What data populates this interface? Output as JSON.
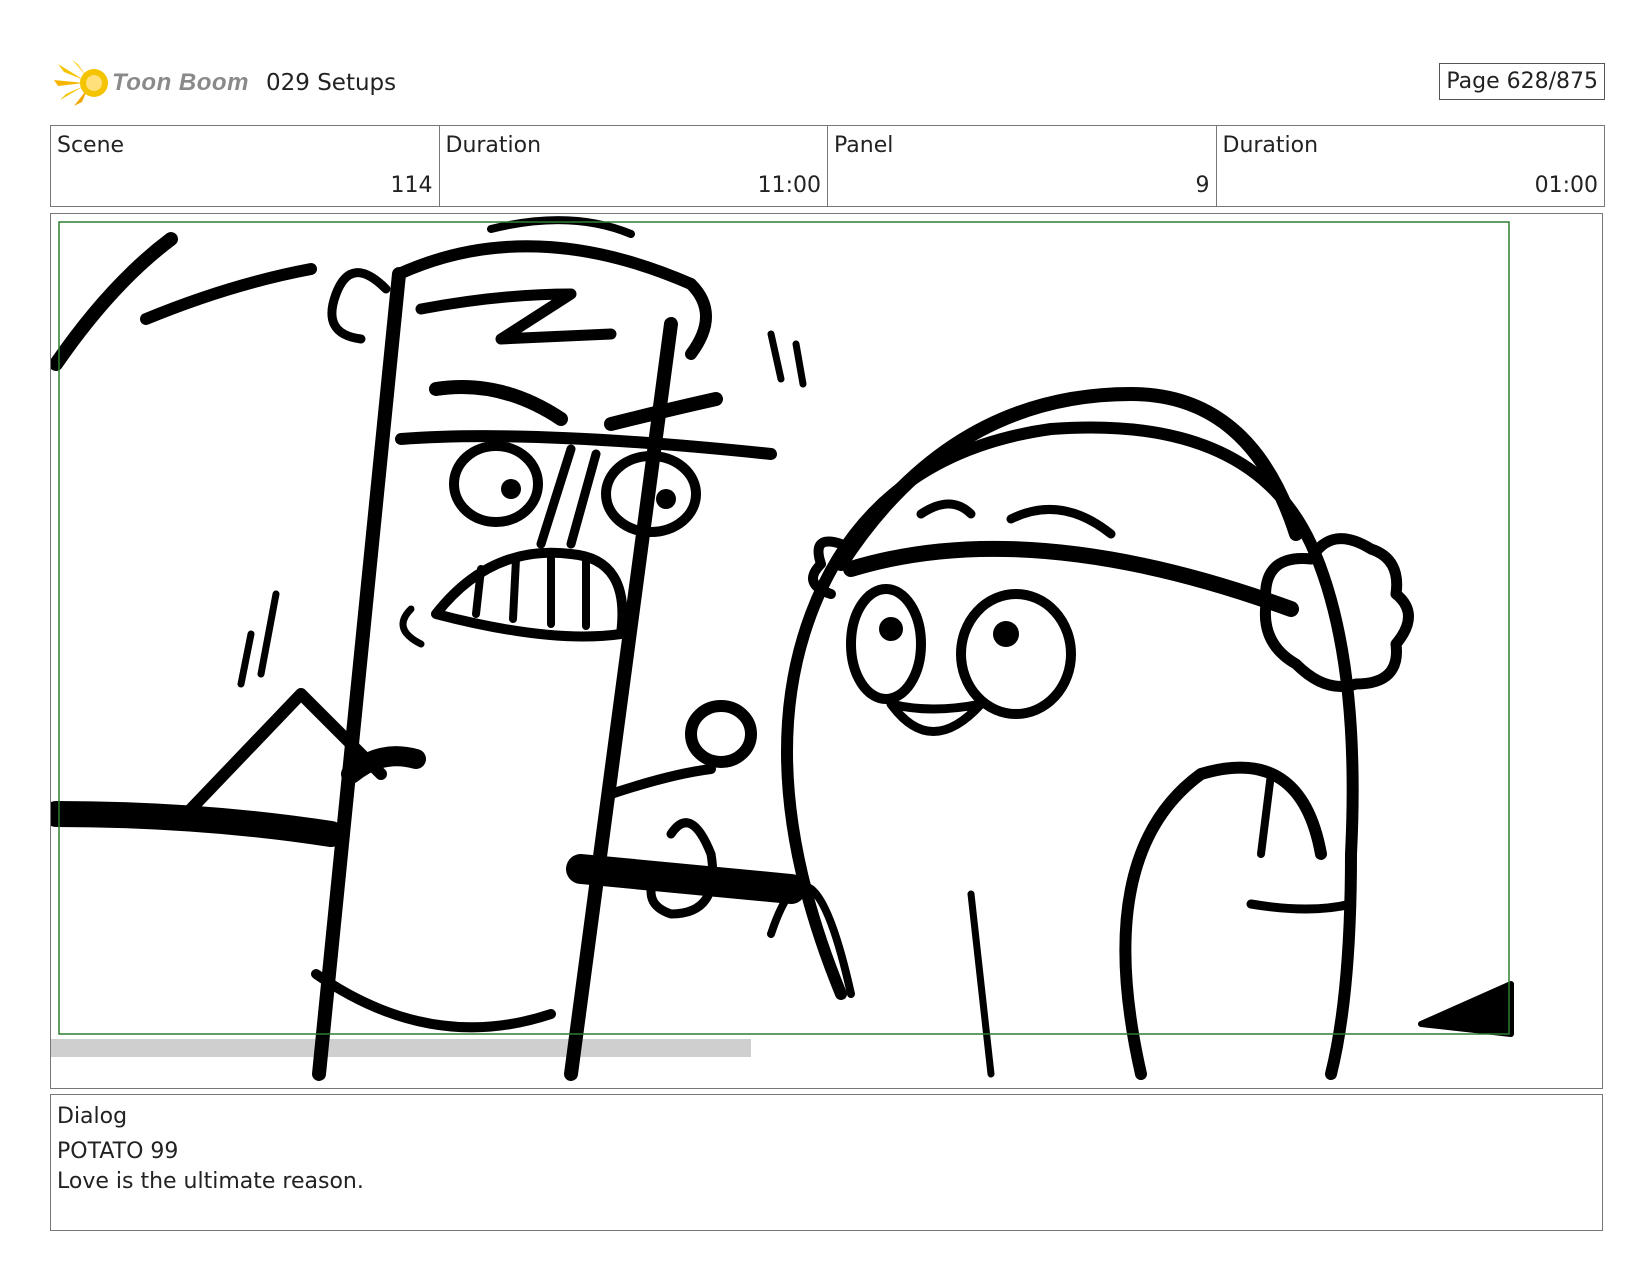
{
  "header": {
    "logo_text": "Toon Boom",
    "project_title": "029 Setups",
    "page_indicator": "Page 628/875"
  },
  "info": {
    "scene_label": "Scene",
    "scene_value": "114",
    "scene_duration_label": "Duration",
    "scene_duration_value": "11:00",
    "panel_label": "Panel",
    "panel_value": "9",
    "panel_duration_label": "Duration",
    "panel_duration_value": "01:00"
  },
  "dialog": {
    "label": "Dialog",
    "speaker": "POTATO 99",
    "line": "Love is the ultimate reason."
  },
  "colors": {
    "logo_yellow": "#f5c400",
    "safe_frame_green": "#2e7d32",
    "ink": "#000000"
  }
}
